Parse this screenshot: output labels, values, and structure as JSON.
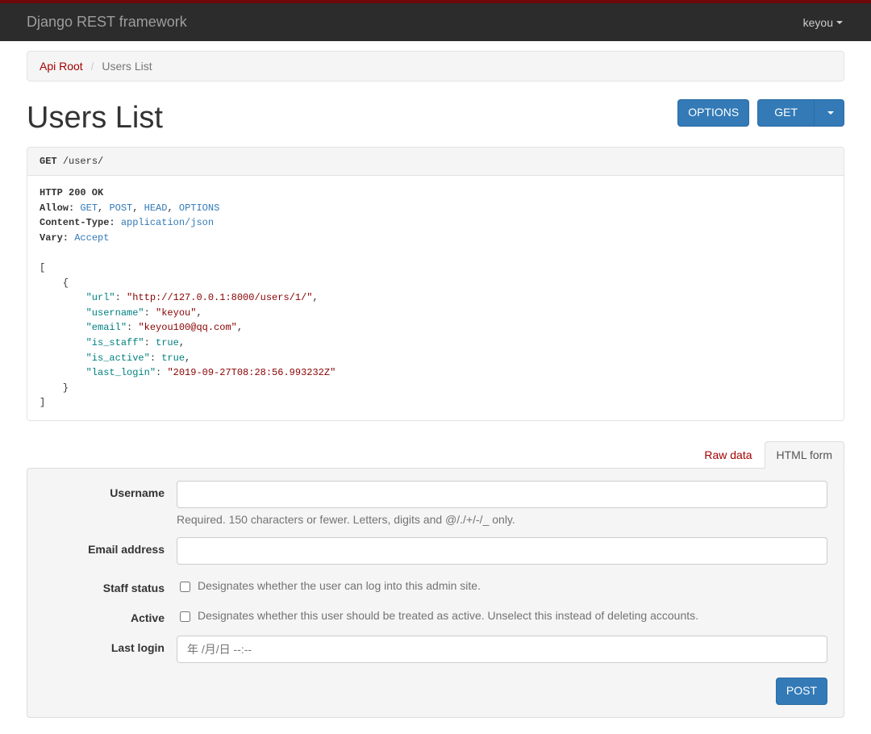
{
  "brand": "Django REST framework",
  "user": "keyou",
  "breadcrumb": {
    "root": "Api Root",
    "current": "Users List"
  },
  "title": "Users List",
  "buttons": {
    "options": "OPTIONS",
    "get": "GET",
    "post": "POST"
  },
  "request": {
    "method": "GET",
    "path": "/users/"
  },
  "response": {
    "status_line": "HTTP 200 OK",
    "headers": {
      "allow_label": "Allow:",
      "allow_values": [
        "GET",
        "POST",
        "HEAD",
        "OPTIONS"
      ],
      "content_type_label": "Content-Type:",
      "content_type_value": "application/json",
      "vary_label": "Vary:",
      "vary_value": "Accept"
    },
    "body": [
      {
        "url": "http://127.0.0.1:8000/users/1/",
        "username": "keyou",
        "email": "keyou100@qq.com",
        "is_staff": true,
        "is_active": true,
        "last_login": "2019-09-27T08:28:56.993232Z"
      }
    ]
  },
  "tabs": {
    "raw": "Raw data",
    "html_form": "HTML form"
  },
  "form": {
    "username_label": "Username",
    "username_help": "Required. 150 characters or fewer. Letters, digits and @/./+/-/_ only.",
    "email_label": "Email address",
    "staff_label": "Staff status",
    "staff_help": "Designates whether the user can log into this admin site.",
    "active_label": "Active",
    "active_help": "Designates whether this user should be treated as active. Unselect this instead of deleting accounts.",
    "last_login_label": "Last login",
    "last_login_placeholder": "年 /月/日 --:--"
  }
}
